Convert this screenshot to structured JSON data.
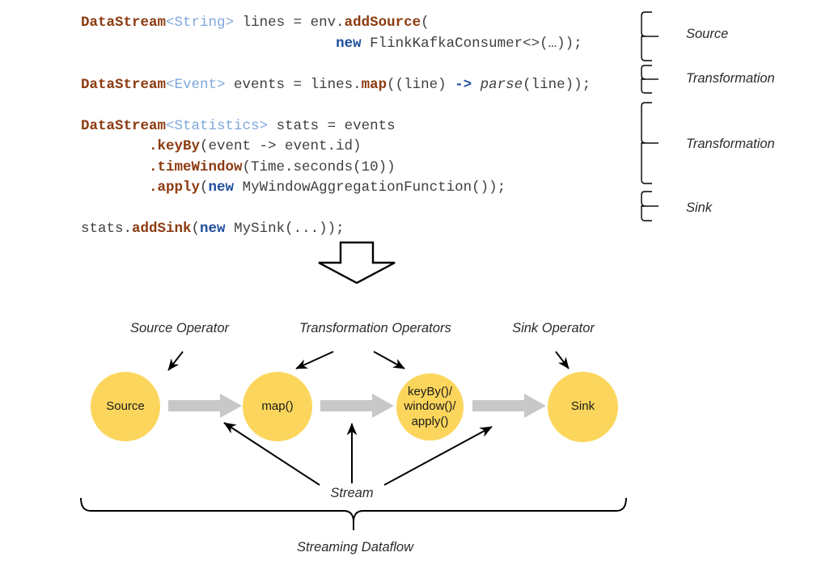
{
  "colors": {
    "node_fill": "#FCD65C",
    "flow_arrow": "#C8C8C8",
    "code_type": "#8C3B10",
    "code_generic": "#7FA8DC",
    "code_keyword": "#1F4E9C",
    "code_plain": "#3F3F3F",
    "line": "#000000",
    "background": "#FFFFFF"
  },
  "code": {
    "lines": [
      {
        "tokens": [
          {
            "t": "DataStream",
            "c": "k-type"
          },
          {
            "t": "<",
            "c": "k-gen"
          },
          {
            "t": "String",
            "c": "k-gen"
          },
          {
            "t": ">",
            "c": "k-gen"
          },
          {
            "t": " lines = env.",
            "c": "k-plain"
          },
          {
            "t": "addSource",
            "c": "k-meth"
          },
          {
            "t": "(",
            "c": "k-plain"
          }
        ]
      },
      {
        "tokens": [
          {
            "t": "                              ",
            "c": "k-plain"
          },
          {
            "t": "new",
            "c": "k-new"
          },
          {
            "t": " FlinkKafkaConsumer<>(…));",
            "c": "k-plain"
          }
        ]
      },
      {
        "tokens": []
      },
      {
        "tokens": [
          {
            "t": "DataStream",
            "c": "k-type"
          },
          {
            "t": "<Event>",
            "c": "k-gen"
          },
          {
            "t": " events = lines.",
            "c": "k-plain"
          },
          {
            "t": "map",
            "c": "k-meth"
          },
          {
            "t": "((line) ",
            "c": "k-plain"
          },
          {
            "t": "->",
            "c": "k-arrow"
          },
          {
            "t": " ",
            "c": "k-plain"
          },
          {
            "t": "parse",
            "c": "k-ital"
          },
          {
            "t": "(line));",
            "c": "k-plain"
          }
        ]
      },
      {
        "tokens": []
      },
      {
        "tokens": [
          {
            "t": "DataStream",
            "c": "k-type"
          },
          {
            "t": "<Statistics>",
            "c": "k-gen"
          },
          {
            "t": " stats = events",
            "c": "k-plain"
          }
        ]
      },
      {
        "tokens": [
          {
            "t": "        ",
            "c": "k-plain"
          },
          {
            "t": ".keyBy",
            "c": "k-meth"
          },
          {
            "t": "(event -> event.id)",
            "c": "k-plain"
          }
        ]
      },
      {
        "tokens": [
          {
            "t": "        ",
            "c": "k-plain"
          },
          {
            "t": ".timeWindow",
            "c": "k-meth"
          },
          {
            "t": "(Time.seconds(10))",
            "c": "k-plain"
          }
        ]
      },
      {
        "tokens": [
          {
            "t": "        ",
            "c": "k-plain"
          },
          {
            "t": ".apply",
            "c": "k-meth"
          },
          {
            "t": "(",
            "c": "k-plain"
          },
          {
            "t": "new",
            "c": "k-new"
          },
          {
            "t": " MyWindowAggregationFunction());",
            "c": "k-plain"
          }
        ]
      },
      {
        "tokens": []
      },
      {
        "tokens": [
          {
            "t": "stats.",
            "c": "k-plain"
          },
          {
            "t": "addSink",
            "c": "k-meth"
          },
          {
            "t": "(",
            "c": "k-plain"
          },
          {
            "t": "new",
            "c": "k-new"
          },
          {
            "t": " MySink(...));",
            "c": "k-plain"
          }
        ]
      }
    ]
  },
  "annotations": {
    "braces": [
      {
        "label": "Source",
        "name": "brace-source"
      },
      {
        "label": "Transformation",
        "name": "brace-transformation-1"
      },
      {
        "label": "Transformation",
        "name": "brace-transformation-2"
      },
      {
        "label": "Sink",
        "name": "brace-sink"
      }
    ]
  },
  "flow": {
    "operator_labels": [
      {
        "line1": "Source",
        "line2": "Operator"
      },
      {
        "line1": "Transformation",
        "line2": "Operators"
      },
      {
        "line1": "Sink",
        "line2": "Operator"
      }
    ],
    "nodes": [
      {
        "name": "node-source",
        "lines": [
          "Source"
        ]
      },
      {
        "name": "node-map",
        "lines": [
          "map()"
        ]
      },
      {
        "name": "node-window",
        "lines": [
          "keyBy()/",
          "window()/",
          "apply()"
        ]
      },
      {
        "name": "node-sink",
        "lines": [
          "Sink"
        ]
      }
    ],
    "stream_label": "Stream",
    "dataflow_label": "Streaming Dataflow"
  },
  "icons": {
    "down_block_arrow": "down-block-arrow-icon",
    "flow_arrow": "right-block-arrow-icon",
    "pointer_arrow": "pointer-arrow-icon",
    "curly_brace": "curly-brace-icon"
  }
}
